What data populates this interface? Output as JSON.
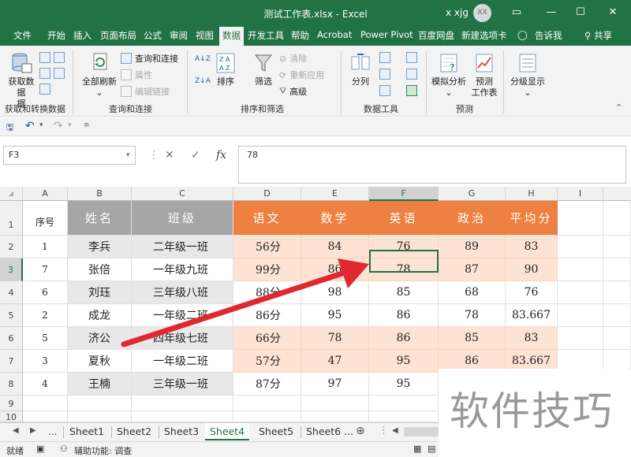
{
  "window": {
    "title": "测试工作表.xlsx  -  Excel",
    "user": "x xjg",
    "avatar": "XX",
    "minimize": "—",
    "restore": "☐",
    "close": "✕"
  },
  "menu": {
    "tabs": [
      "文件",
      "开始",
      "插入",
      "页面布局",
      "公式",
      "审阅",
      "视图",
      "数据",
      "开发工具",
      "帮助",
      "Acrobat",
      "Power Pivot",
      "百度网盘",
      "新建选项卡"
    ],
    "active": "数据",
    "tell_me": "告诉我",
    "share": "共享"
  },
  "ribbon": {
    "get_data": "获取数据",
    "get_data_suffix": "据",
    "group_get": "获取和转换数据",
    "refresh_all": "全部刷新",
    "queries": "查询和连接",
    "properties": "属性",
    "edit_links": "编辑链接",
    "group_queries": "查询和连接",
    "sort": "排序",
    "filter": "筛选",
    "clear": "清除",
    "reapply": "重新应用",
    "advanced": "高级",
    "group_sort": "排序和筛选",
    "text_to_columns": "分列",
    "group_tools": "数据工具",
    "what_if": "模拟分析",
    "forecast_sheet": "预测\n工作表",
    "group_forecast": "预测",
    "outline": "分级显示"
  },
  "formula_bar": {
    "name_box": "F3",
    "fx": "fx",
    "cancel": "✕",
    "enter": "✓",
    "content": "78"
  },
  "columns": [
    "A",
    "B",
    "C",
    "D",
    "E",
    "F",
    "G",
    "H",
    "I"
  ],
  "selected_column": "F",
  "rows": [
    "1",
    "2",
    "3",
    "4",
    "5",
    "6",
    "7",
    "8",
    "9",
    "10"
  ],
  "selected_row": "3",
  "table": {
    "headers": [
      "序号",
      "姓名",
      "班级",
      "语文",
      "数学",
      "英语",
      "政治",
      "平均分"
    ],
    "records": [
      [
        "1",
        "李兵",
        "二年级一班",
        "56分",
        "84",
        "76",
        "89",
        "83"
      ],
      [
        "7",
        "张倍",
        "一年级九班",
        "99分",
        "86",
        "78",
        "87",
        "90"
      ],
      [
        "6",
        "刘珏",
        "三年级八班",
        "88分",
        "98",
        "85",
        "68",
        "76"
      ],
      [
        "2",
        "成龙",
        "一年级二班",
        "86分",
        "95",
        "86",
        "78",
        "83.667"
      ],
      [
        "5",
        "济公",
        "四年级七班",
        "66分",
        "78",
        "86",
        "85",
        "83"
      ],
      [
        "3",
        "夏秋",
        "一年级二班",
        "57分",
        "47",
        "95",
        "86",
        "83.667"
      ],
      [
        "4",
        "王楠",
        "三年级一班",
        "87分",
        "97",
        "95",
        "",
        ""
      ]
    ]
  },
  "sheets": {
    "tabs": [
      "Sheet1",
      "Sheet2",
      "Sheet3",
      "Sheet4",
      "Sheet5",
      "Sheet6 ..."
    ],
    "active": "Sheet4",
    "ellipsis": "..."
  },
  "status": {
    "ready": "就绪",
    "accessibility": "辅助功能: 调查"
  },
  "watermark": "软件技巧",
  "colors": {
    "excel_green": "#217346",
    "header_orange": "#ee8042",
    "header_gray": "#a6a6a6",
    "row_peach": "#fde3d3",
    "annotation_red": "#e0282e"
  }
}
